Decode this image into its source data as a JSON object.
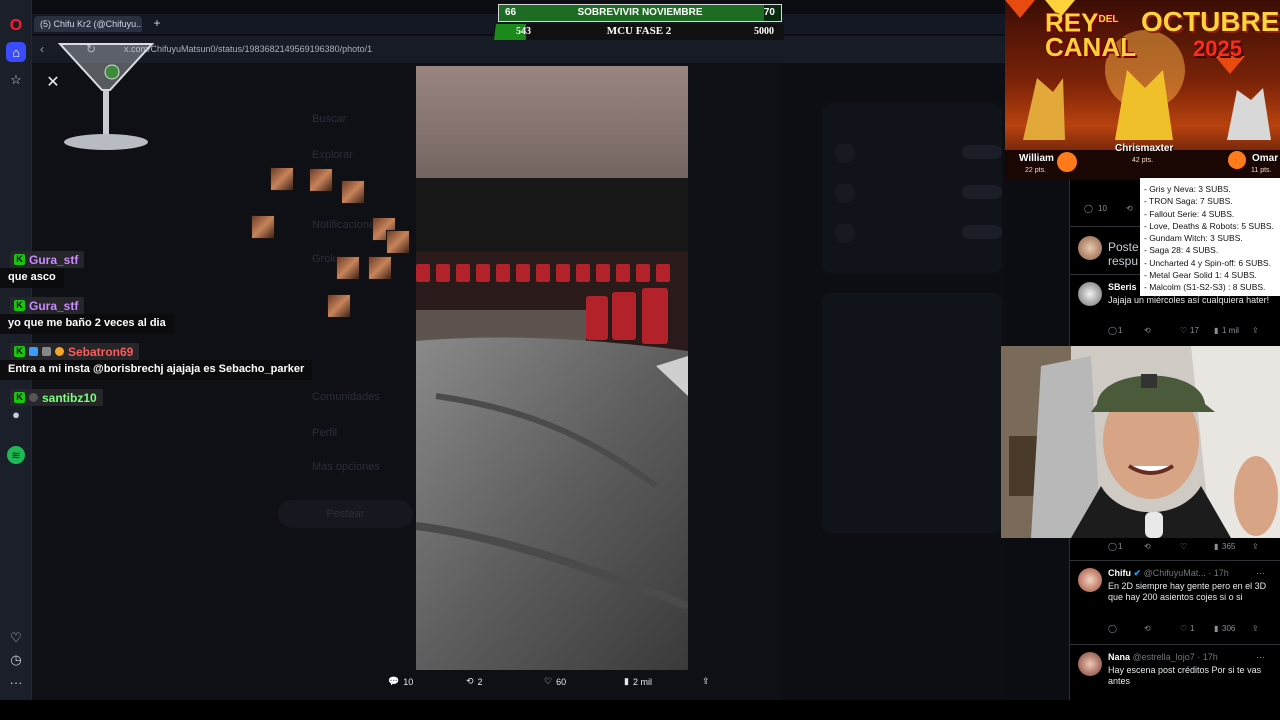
{
  "browser": {
    "tab_title": "(5) Chifu Kr2 (@Chifuyu...",
    "url": "x.com/ChifuyuMatsun0/status/1983682149569196380/photo/1"
  },
  "hud": {
    "goal1": {
      "left": "66",
      "title": "SOBREVIVIR NOVIEMBRE",
      "right": "70",
      "progress": 0.94
    },
    "goal2": {
      "left": "543",
      "title": "MCU FASE 2",
      "right": "5000",
      "progress": 0.11
    }
  },
  "ghost_nav": [
    "Buscar",
    "Explorar",
    "Notificaciones",
    "Grok",
    "Comunidades",
    "Perfil",
    "Más opciones"
  ],
  "ghost_button": "Postear",
  "photo_actions": {
    "replies": "10",
    "reposts": "2",
    "likes": "60",
    "views": "2 mil"
  },
  "chat": [
    {
      "user": "Gura_stf",
      "color": "#c98bff",
      "text": "que asco"
    },
    {
      "user": "Gura_stf",
      "color": "#c98bff",
      "text": "yo que me baño 2 veces al dia"
    },
    {
      "user": "Sebatron69",
      "color": "#ff5a5a",
      "text": "Entra a mi insta @borisbrechj ajajaja es Sebacho_parker"
    },
    {
      "user": "santibz10",
      "color": "#7dff7d",
      "text": ""
    }
  ],
  "rey_del_canal": {
    "title_a": "REY",
    "title_del": "DEL",
    "title_b": "CANAL",
    "month": "OCTUBRE",
    "year": "2025",
    "players": [
      {
        "name": "William",
        "pts": "22 pts."
      },
      {
        "name": "Chrismaxter",
        "pts": "42 pts."
      },
      {
        "name": "Omar",
        "pts": "11 pts."
      }
    ]
  },
  "subs_list": [
    "- Gris y Neva: 3 SUBS.",
    "- TRON Saga: 7 SUBS.",
    "- Fallout Serie: 4 SUBS.",
    "- Love, Deaths & Robots: 5 SUBS.",
    "- Gundam Witch: 3 SUBS.",
    "- Saga 28: 4 SUBS.",
    "- Uncharted 4 y Spin-off: 6 SUBS.",
    "- Metal Gear Solid 1: 4 SUBS.",
    "- Malcolm (S1-S2-S3) : 8 SUBS."
  ],
  "tweets": {
    "t0_stats": {
      "replies": "10"
    },
    "t1": {
      "partial": "Poste",
      "partial2": "respu"
    },
    "t2": {
      "name": "SBeris",
      "body": "Jajaja un miércoles así cualquiera hater!",
      "replies": "1",
      "likes": "17",
      "views": "1 mil"
    },
    "t3_stats": {
      "replies": "1",
      "views": "365"
    },
    "t4": {
      "name": "Chifu",
      "handle": "@ChifuyuMat... · 17h",
      "body": "En 2D siempre hay gente pero en el 3D que hay 200 asientos cojes si o si",
      "replies": "",
      "likes": "1",
      "views": "306"
    },
    "t5": {
      "name": "Nana",
      "handle": "@estrella_lojo7 · 17h",
      "body": "Hay escena post créditos Por si te vas antes"
    }
  },
  "colors": {
    "accent": "#1d9bf0",
    "hud_green": "#1e6b24",
    "kick_green": "#18c60b"
  }
}
